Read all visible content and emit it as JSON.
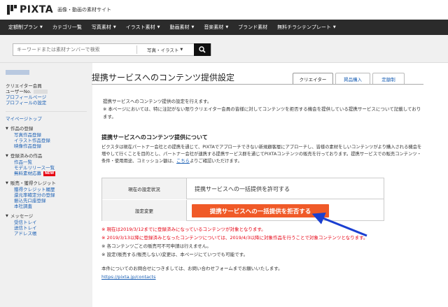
{
  "header": {
    "logo_text": "PIXTA",
    "tagline": "画像・動画の素材サイト"
  },
  "nav": {
    "items": [
      {
        "label": "定額制プラン",
        "caret": true
      },
      {
        "label": "カテゴリ一覧",
        "caret": false
      },
      {
        "label": "写真素材",
        "caret": true
      },
      {
        "label": "イラスト素材",
        "caret": true
      },
      {
        "label": "動画素材",
        "caret": true
      },
      {
        "label": "音楽素材",
        "caret": true
      },
      {
        "label": "ブランド素材",
        "caret": false
      },
      {
        "label": "無料チラシテンプレート",
        "caret": true
      }
    ]
  },
  "search": {
    "placeholder": "キーワードまたは素材ナンバーで検索",
    "type_selected": "写真・イラスト"
  },
  "sidebar": {
    "member_label": "クリエイター会員",
    "user_no_label": "ユーザーNo.",
    "profile_page": "プロフィールページ",
    "profile_settings": "プロフィールの設定",
    "mypage_top": "マイページトップ",
    "sections": [
      {
        "title": "作品の登録",
        "items": [
          {
            "label": "写真作品登録",
            "badge": ""
          },
          {
            "label": "イラスト作品登録",
            "badge": ""
          },
          {
            "label": "映像作品登録",
            "badge": ""
          }
        ]
      },
      {
        "title": "登録済みの作品",
        "items": [
          {
            "label": "作品一覧",
            "badge": ""
          },
          {
            "label": "モデルリリース一覧",
            "badge": ""
          },
          {
            "label": "無料素材応募",
            "badge": "NEW"
          }
        ]
      },
      {
        "title": "販売・獲得クレジット",
        "items": [
          {
            "label": "獲得クレジット履歴",
            "badge": ""
          },
          {
            "label": "還元率確定分の登録",
            "badge": ""
          },
          {
            "label": "振込先口座登録",
            "badge": ""
          },
          {
            "label": "本社調査",
            "badge": ""
          }
        ]
      },
      {
        "title": "メッセージ",
        "items": [
          {
            "label": "受信トレイ",
            "badge": ""
          },
          {
            "label": "送信トレイ",
            "badge": ""
          },
          {
            "label": "アドレス帳",
            "badge": ""
          }
        ]
      }
    ]
  },
  "main": {
    "title": "提携サービスへのコンテンツ提供設定",
    "tabs": [
      "クリエイター",
      "掲品購入",
      "定額制"
    ],
    "intro": [
      "提携サービスへのコンテンツ提供の設定を行えます。",
      "※ 本ページにおいては、特に注記がない限りクリエイター会員の皆様に対してコンテンツを拒否する機会を提供している提携サービスについて記載しております。"
    ],
    "section_title": "提携サービスへのコンテンツ提供について",
    "section_text": "ピクスタは現在パートナー会社との提携を通じて、PIXTAでアプローチできない新規顧客層にアプローチし、皆様の素材をしいコンテンツがより購入される機会を増やして行くことを目的とし、パートナー会社が連携する提携サービス群を通じてPIXTAコンテンツの販売を行っております。提携サービスでの販売コンテンツ・条件・使用用途、コミッション額は、",
    "section_link": "こちら",
    "section_text_after": "よりご確認いただけます。",
    "status_label": "現在の設定状況",
    "status_value": "提携サービスへの一括提供を許可する",
    "setting_label": "設定変更",
    "refuse_button": "提携サービスへの一括提供を拒否する",
    "notes_red": [
      "※ 現在は2019/3/12までに登録済みになっているコンテンツが対象となります。",
      "※ 2019/3/13以降に登録済みとなったコンテンツについては、2019/4/3以降に対象作品を行うことで対象コンテンツとなります。"
    ],
    "notes_black": [
      "※ 各コンテンツごとの販売可不可申請は行えません。",
      "※ 設定(販売する/販売しない)変更は、本ページにていつでも可能です。"
    ],
    "contact_text": "本件についてのお問合せにつきましては、お問い合わせフォームまでお願いいたします。",
    "contact_url": "https://pixta.jp/contacts"
  },
  "colors": {
    "nav_bg": "#2b2b2b",
    "accent_orange": "#f05a28",
    "arrow_blue": "#1a3fd1",
    "note_red": "#e60012"
  }
}
